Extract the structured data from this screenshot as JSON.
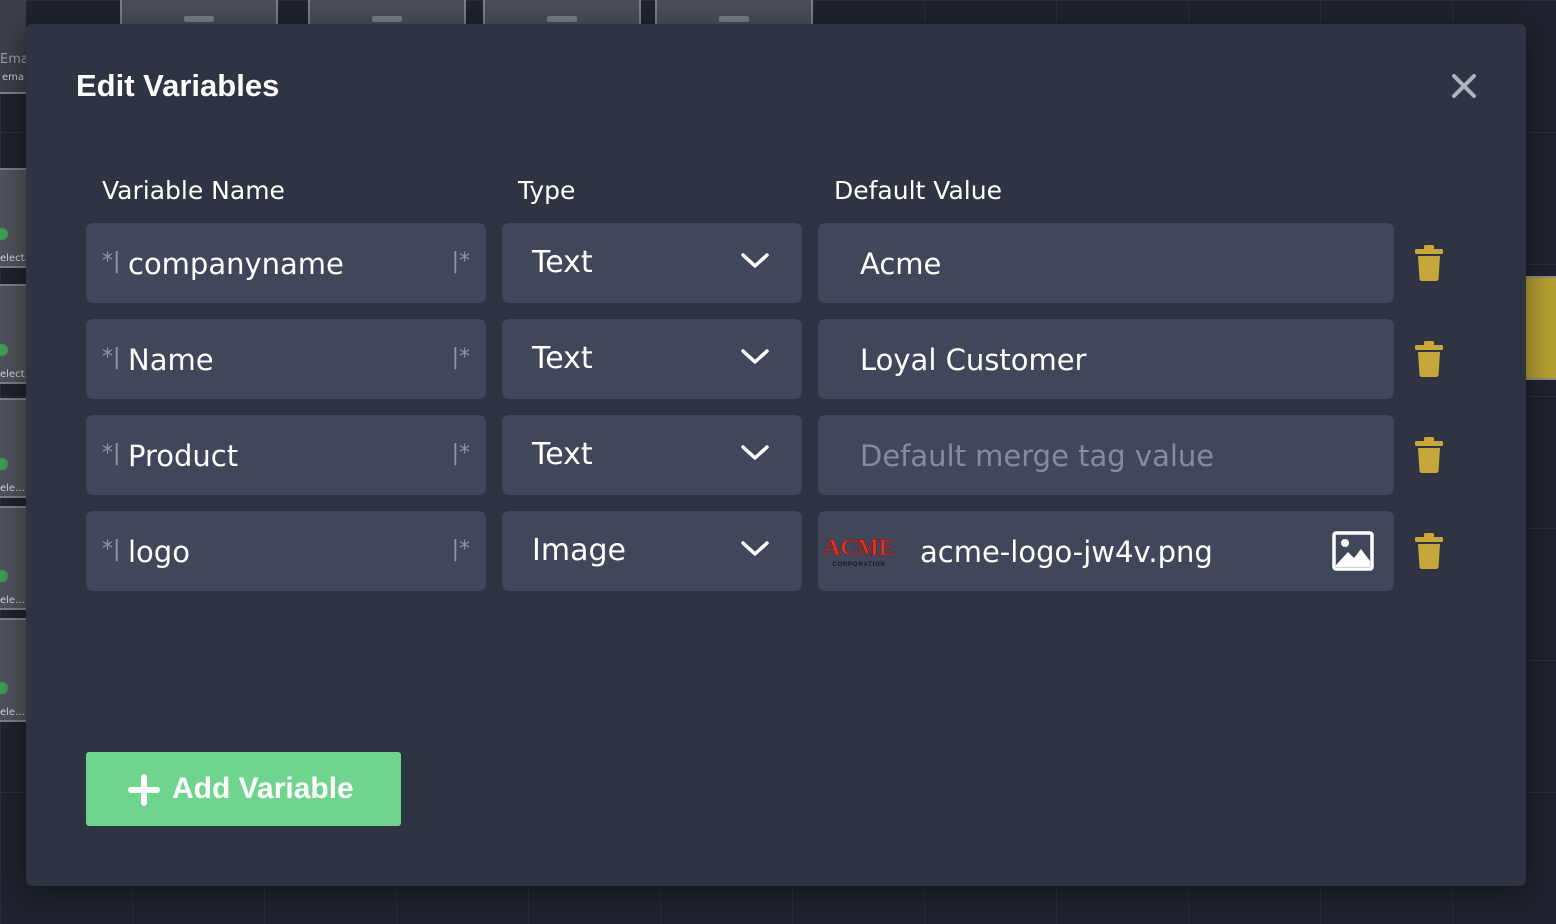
{
  "background": {
    "email_node": {
      "title": "Ema",
      "subtitle": "ema"
    },
    "left_nodes": [
      {
        "label": "elect."
      },
      {
        "label": "elect."
      },
      {
        "label": "ele..."
      },
      {
        "label": "ele..."
      },
      {
        "label": "ele..."
      }
    ]
  },
  "dialog": {
    "title": "Edit Variables",
    "close_icon": "close-icon",
    "columns": {
      "name": "Variable Name",
      "type": "Type",
      "default": "Default Value"
    },
    "merge_prefix": "*|",
    "merge_suffix": "|*",
    "variables": [
      {
        "name": "companyname",
        "type": "Text",
        "default_value": "Acme",
        "placeholder": ""
      },
      {
        "name": "Name",
        "type": "Text",
        "default_value": "Loyal Customer",
        "placeholder": ""
      },
      {
        "name": "Product",
        "type": "Text",
        "default_value": "",
        "placeholder": "Default merge tag value"
      },
      {
        "name": "logo",
        "type": "Image",
        "file_name": "acme-logo-jw4v.png",
        "logo_text": "ACME",
        "logo_subtext": "CORPORATION"
      }
    ],
    "add_button_label": "Add Variable"
  },
  "colors": {
    "accent_green": "#6fd48e",
    "trash_gold": "#c6a83a",
    "field_bg": "#41475a",
    "modal_bg": "#2f3443"
  }
}
